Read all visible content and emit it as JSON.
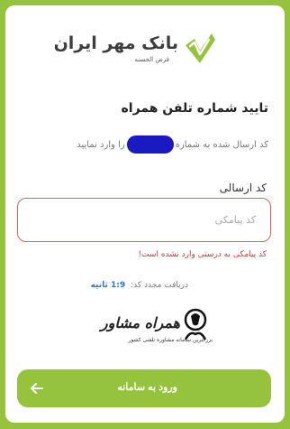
{
  "brand": {
    "name": "بانک مهر ایران",
    "subtitle": "قرض الحسنه",
    "colors": {
      "primary": "#95c33d",
      "error": "#e03333",
      "link": "#2a79c8"
    }
  },
  "page": {
    "title": "تایید شماره تلفن همراه",
    "description_before": "کد ارسال شده به شماره",
    "description_after": "را وارد نمایید"
  },
  "form": {
    "code_label": "کد ارسالی",
    "code_placeholder": "کد پیامکی",
    "code_value": "",
    "error": "کد پیامکی به درستی وارد نشده است!",
    "resend_label": "دریافت مجدد کد:",
    "resend_timer": "1:9 ثانیه",
    "submit_label": "ورود به سامانه",
    "submit_icon": "arrow-left-icon"
  },
  "watermark": {
    "title": "همراه مشاور",
    "subtitle": "بزرگترین سامانه مشاوره تلفنی کشور",
    "icon": "phone-headset-icon"
  }
}
